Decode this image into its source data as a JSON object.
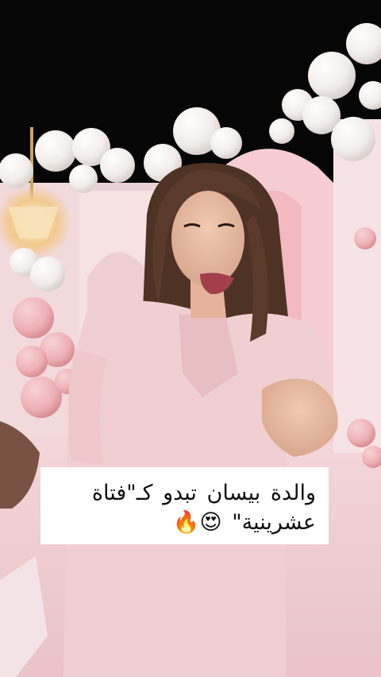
{
  "caption": {
    "line1": "والدة بيسان تبدو كـ\"فتاة",
    "line2": "عشرينية\" 😍🔥"
  },
  "colors": {
    "night_sky": "#050505",
    "backdrop_pink": "#f3dade",
    "balloon_white": "#f7f4f2",
    "balloon_pink": "#f0b8bd",
    "dress_pink": "#f0cfd2",
    "hair_brown": "#5a3a2a",
    "caption_bg": "#ffffff",
    "caption_text": "#111111"
  },
  "scene": {
    "subject": "woman-in-pink-dress",
    "setting": "balloon-party-backdrop"
  }
}
